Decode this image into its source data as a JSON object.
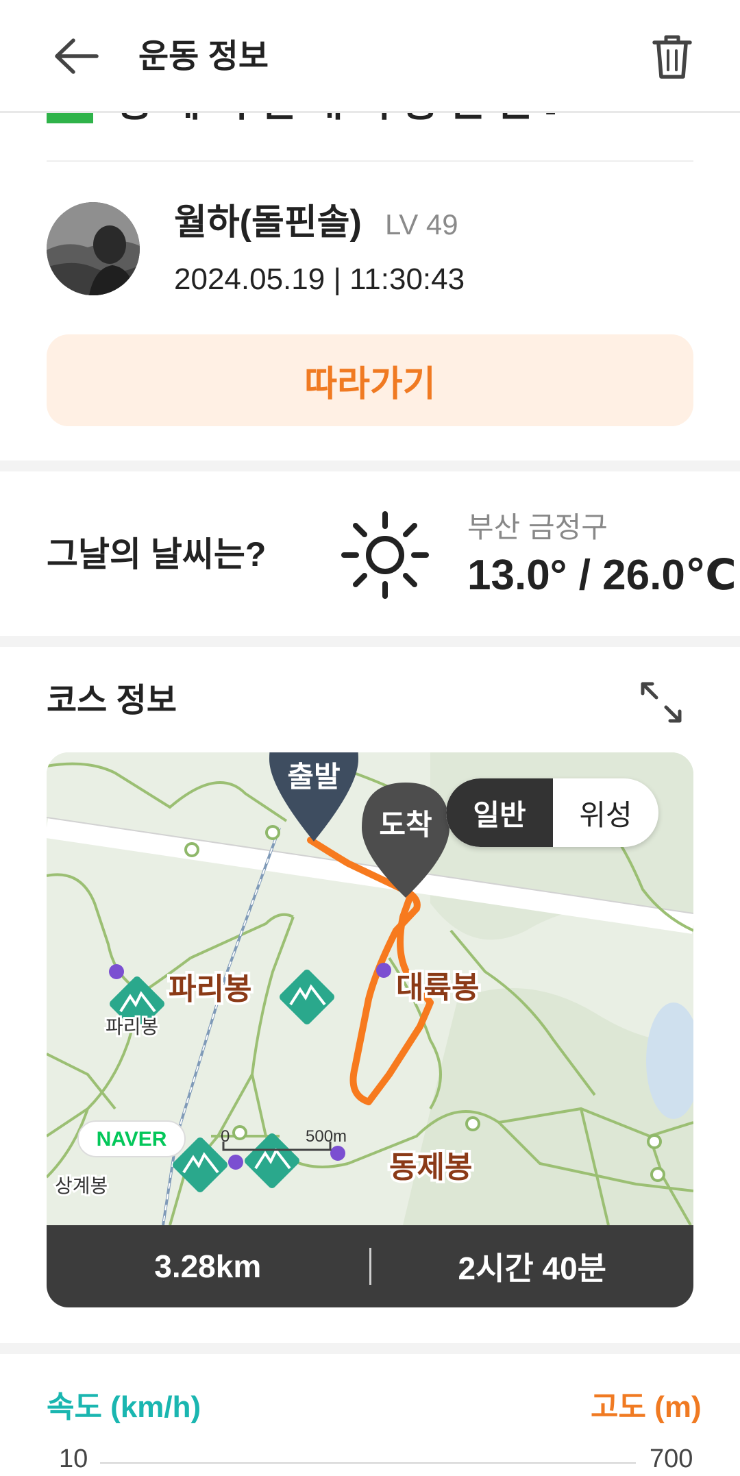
{
  "header": {
    "title": "운동 정보",
    "back_icon": "arrow-left-icon",
    "trash_icon": "trash-icon"
  },
  "post": {
    "title_partial": "동 에 어 일 대 지 등 는 는 그 비"
  },
  "profile": {
    "name": "월하(돌핀솔)",
    "level": "LV 49",
    "datetime": "2024.05.19 | 11:30:43"
  },
  "follow_button": {
    "label": "따라가기"
  },
  "weather": {
    "question": "그날의 날씨는?",
    "location": "부산 금정구",
    "temperature": "13.0° / 26.0℃",
    "icon": "sun-icon"
  },
  "course": {
    "title": "코스 정보",
    "map": {
      "toggle": {
        "normal": "일반",
        "satellite": "위성",
        "selected": "일반"
      },
      "markers": {
        "start": "출발",
        "end": "도착"
      },
      "peaks": {
        "pari_big": "파리봉",
        "pari_small": "파리봉",
        "daeryuk": "대륙봉",
        "dongje": "동제봉",
        "sanggye": "상계봉"
      },
      "scale": {
        "zero": "0",
        "distance": "500m"
      },
      "logo": "NAVER"
    },
    "distance": "3.28km",
    "duration": "2시간 40분"
  },
  "chart_header": {
    "speed_label": "속도 (km/h)",
    "altitude_label": "고도 (m)",
    "speed_max": "10",
    "altitude_max": "700"
  },
  "colors": {
    "accent": "#f07a22",
    "follow_bg": "#fff0e4",
    "speed": "#1ab6b0",
    "route": "#f77a1e",
    "stats_bg": "#3c3c3c"
  }
}
